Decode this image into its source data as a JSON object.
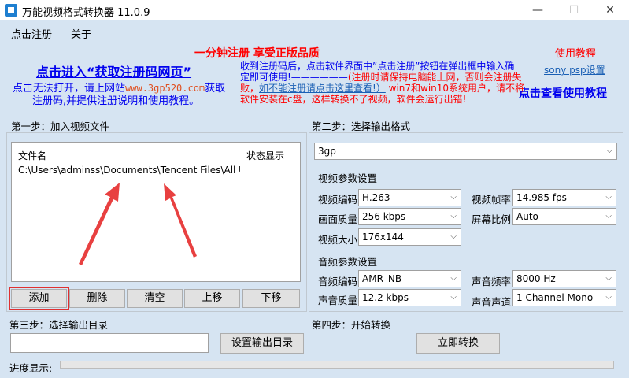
{
  "window": {
    "title": "万能视频格式转换器 11.0.9",
    "minimize": "—",
    "maximize": "☐",
    "close": "✕"
  },
  "menu": [
    "点击注册",
    "关于"
  ],
  "promo": {
    "headline": "一分钟注册  享受正版品质",
    "get_code_link": "点击进入“获取注册码网页”",
    "fallback_1": "点击无法打开，请上网站",
    "site": "www.3gp520.com",
    "fallback_2": "获取",
    "fallback_3": "注册码,并提供注册说明和使用教程。",
    "instr_1": "收到注册码后，点击软件界面中”点击注册”按钮在弹出框中输入确",
    "instr_2a": "定即可使用!——————",
    "instr_2b": "(注册时请保持电脑能上网，否则会注册失",
    "instr_3a": "败，",
    "instr_3link": "如不能注册请点击这里查看!）",
    "instr_3b": " win7和win10系统用户，请不将",
    "instr_4": "软件安装在c盘，这样转换不了视频，软件会运行出错!",
    "tutorial_title": "使用教程",
    "psp_link": "sony psp设置",
    "tutorial_link": "点击查看使用教程"
  },
  "step1": {
    "title": "第一步：加入视频文件",
    "columns": [
      "文件名",
      "状态显示"
    ],
    "files": [
      {
        "name": "C:\\Users\\adminss\\Documents\\Tencent Files\\All U...",
        "status": ""
      }
    ],
    "buttons": [
      "添加",
      "删除",
      "清空",
      "上移",
      "下移"
    ]
  },
  "step2": {
    "title": "第二步：选择输出格式",
    "format": "3gp",
    "video_group": "视频参数设置",
    "video": [
      {
        "label": "视频编码",
        "value": "H.263"
      },
      {
        "label": "视频帧率",
        "value": "14.985 fps"
      },
      {
        "label": "画面质量",
        "value": "256 kbps"
      },
      {
        "label": "屏幕比例",
        "value": "Auto"
      },
      {
        "label": "视频大小",
        "value": "176x144"
      }
    ],
    "audio_group": "音频参数设置",
    "audio": [
      {
        "label": "音频编码",
        "value": "AMR_NB"
      },
      {
        "label": "声音频率",
        "value": "8000 Hz"
      },
      {
        "label": "声音质量",
        "value": "12.2 kbps"
      },
      {
        "label": "声音声道",
        "value": "1 Channel Mono"
      }
    ]
  },
  "step3": {
    "title": "第三步：选择输出目录",
    "path": "",
    "button": "设置输出目录"
  },
  "step4": {
    "title": "第四步：开始转换",
    "button": "立即转换"
  },
  "progress": {
    "label": "进度显示:",
    "value": 0
  }
}
